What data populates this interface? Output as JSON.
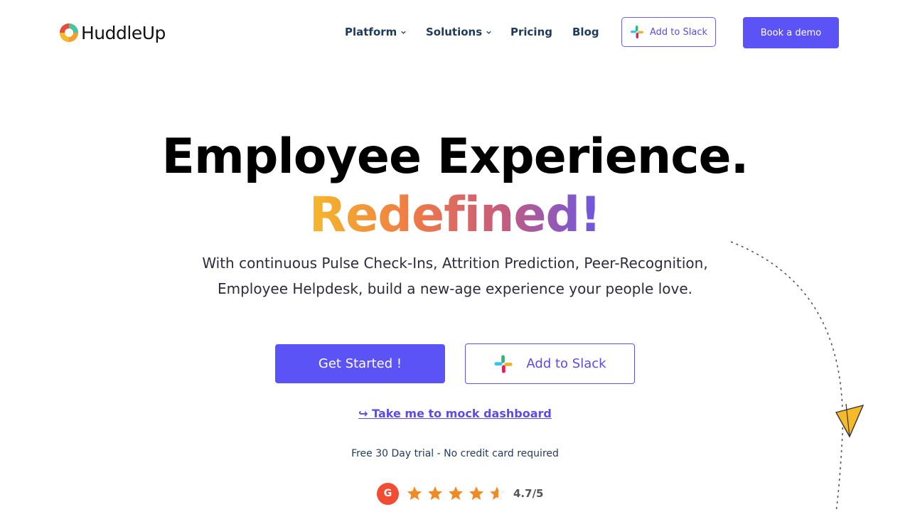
{
  "brand": {
    "name": "HuddleUp"
  },
  "nav": {
    "platform": "Platform",
    "solutions": "Solutions",
    "pricing": "Pricing",
    "blog": "Blog",
    "add_to_slack": "Add to Slack",
    "book_demo": "Book a demo"
  },
  "hero": {
    "title": "Employee Experience.",
    "subtitle": "Redefined!",
    "description_line1": "With continuous Pulse Check-Ins, Attrition Prediction, Peer-Recognition,",
    "description_line2": "Employee Helpdesk, build a new-age experience your people love.",
    "get_started": "Get Started !",
    "add_to_slack": "Add to Slack",
    "mock_link": "↪ Take me to mock dashboard",
    "trial_note": "Free 30 Day trial - No credit card required"
  },
  "rating": {
    "badge": "G",
    "value": 4.7,
    "text": "4.7/5"
  },
  "colors": {
    "accent": "#5b53f5",
    "nav_text": "#1f3a5a",
    "star": "#f08a24",
    "g2_badge": "#f04d34"
  },
  "icons": [
    "chevron-down-icon",
    "slack-icon",
    "star-icon",
    "paper-plane-icon",
    "g2-logo"
  ]
}
